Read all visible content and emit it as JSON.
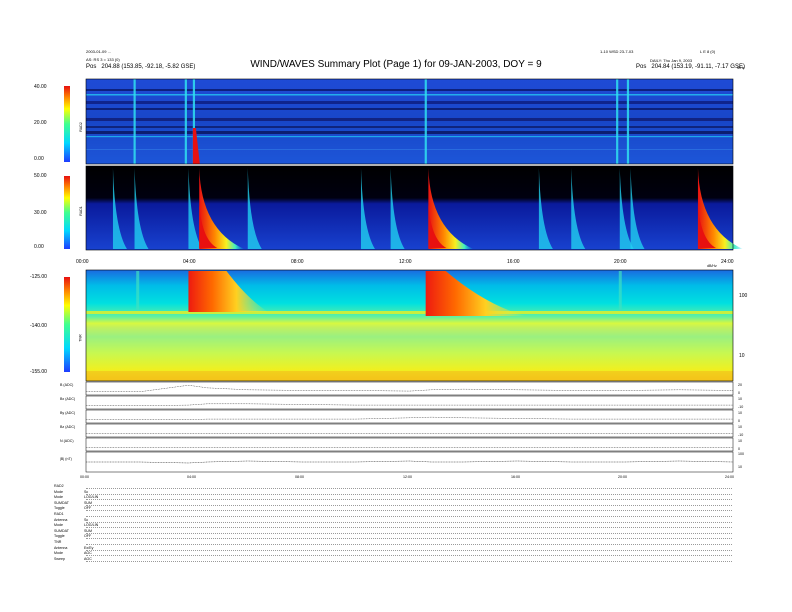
{
  "header": {
    "left_line1": "2003-01-09 ...",
    "left_line2": "AS: RS 3 = 133 (0)",
    "left_pos_label": "Pos",
    "left_pos_value": "204.88 (153.85, -92.18, -5.82 GSE)",
    "right_line1": "1-10 WSD 23-7-03",
    "right_line2": "L E 8 (0)",
    "right_line3": "DAILY: Thu Jan 9, 2003",
    "right_pos_label": "Pos",
    "right_pos_value": "204.84 (153.19, -91.11, -7.17 GSE)",
    "title": "WIND/WAVES Summary Plot (Page 1) for 09-JAN-2003, DOY = 9"
  },
  "panels": {
    "rad2": {
      "label": "RAD2",
      "ticks": [
        "40.00",
        "20.00",
        "0.00"
      ]
    },
    "rad1": {
      "label": "RAD1",
      "ticks": [
        "50.00",
        "30.00",
        "0.00"
      ]
    },
    "tnr": {
      "label": "TNR",
      "ticks": [
        "-125.00",
        "-140.00",
        "-155.00"
      ],
      "right_ticks": [
        "100",
        "10"
      ]
    },
    "time_ticks": [
      "00:00",
      "04:00",
      "08:00",
      "12:00",
      "16:00",
      "20:00",
      "24:00"
    ],
    "top_right_mark": "MHz",
    "mid_right_mark": "dB/Hz"
  },
  "mfi": {
    "labels": [
      "B (ADC)",
      "Bx (ADC)",
      "By (ADC)",
      "Bz (ADC)",
      "N (ADC)",
      "|B| (nT)"
    ],
    "right_ticks": [
      [
        "20",
        "0"
      ],
      [
        "10",
        "-10"
      ],
      [
        "10",
        "0"
      ],
      [
        "10",
        "-10"
      ],
      [
        "10",
        "0"
      ],
      [
        "100",
        "10"
      ]
    ],
    "time_ticks": [
      "00:00",
      "04:00",
      "08:00",
      "12:00",
      "16:00",
      "20:00",
      "24:00"
    ]
  },
  "params": [
    {
      "k": "RAD2",
      "v": ""
    },
    {
      "k": "Mode",
      "v": "Sc"
    },
    {
      "k": "Mode",
      "v": "LOG/LIN"
    },
    {
      "k": "SUMDAT",
      "v": "SUM"
    },
    {
      "k": "Toggle",
      "v": "OFF"
    },
    {
      "k": "RAD1",
      "v": ""
    },
    {
      "k": "Antenna",
      "v": "Sc"
    },
    {
      "k": "Mode",
      "v": "LOG/LIN"
    },
    {
      "k": "SUMDAT",
      "v": "SUM"
    },
    {
      "k": "Toggle",
      "v": "OFF"
    },
    {
      "k": "TNR",
      "v": ""
    },
    {
      "k": "Antenna",
      "v": "Ex/Ey"
    },
    {
      "k": "Mode",
      "v": "AGC"
    },
    {
      "k": "Sweep",
      "v": "AGC"
    }
  ],
  "chart_data": [
    {
      "type": "heatmap",
      "title": "WIND/WAVES Summary Plot (Page 1) for 09-JAN-2003, DOY = 9",
      "panel": "RAD2",
      "ylabel": "RAD2",
      "xlim": [
        "00:00",
        "24:00"
      ],
      "colorbar_ticks": [
        "40.00",
        "20.00",
        "0.00"
      ],
      "bursts_hours": [
        1.8,
        3.7,
        4.0,
        12.6,
        19.7,
        20.1
      ]
    },
    {
      "type": "heatmap",
      "panel": "RAD1",
      "ylabel": "RAD1",
      "xlim": [
        "00:00",
        "24:00"
      ],
      "colorbar_ticks": [
        "50.00",
        "30.00",
        "0.00"
      ],
      "bursts_hours": [
        1.0,
        1.8,
        3.8,
        4.2,
        6.0,
        10.2,
        11.3,
        12.7,
        16.8,
        18.0,
        19.8,
        20.2,
        22.7
      ]
    },
    {
      "type": "heatmap",
      "panel": "TNR",
      "ylabel": "TNR",
      "xlim": [
        "00:00",
        "24:00"
      ],
      "colorbar_ticks": [
        "-125.00",
        "-140.00",
        "-155.00"
      ],
      "right_axis_ticks": [
        "100",
        "10"
      ],
      "bursts_hours": [
        1.9,
        3.8,
        12.6,
        19.8
      ]
    },
    {
      "type": "line",
      "panel": "MFI",
      "x": [
        0,
        2,
        3.8,
        4.5,
        6,
        8,
        10,
        12,
        12.8,
        14,
        16,
        18,
        20,
        22,
        24
      ],
      "series": [
        {
          "name": "B (ADC)",
          "values": [
            0,
            0,
            1,
            0.6,
            0.3,
            0.2,
            0.2,
            0.1,
            0.3,
            0.4,
            0.3,
            0.2,
            0.2,
            0.3,
            0.2
          ]
        },
        {
          "name": "Bx (ADC)",
          "values": [
            0,
            0,
            0.1,
            0.3,
            0.3,
            0.2,
            0.1,
            0.1,
            0.1,
            0.1,
            0.1,
            0.1,
            0.1,
            0.1,
            0.1
          ]
        },
        {
          "name": "By (ADC)",
          "values": [
            0,
            0,
            0,
            0.1,
            0.1,
            0.1,
            0.1,
            0.3,
            0.4,
            0.3,
            0.2,
            0.1,
            0.1,
            0.1,
            0.1
          ]
        },
        {
          "name": "Bz (ADC)",
          "values": [
            0,
            0,
            0,
            0,
            0,
            0,
            0,
            0,
            0,
            0,
            0,
            0,
            0,
            0,
            0
          ]
        },
        {
          "name": "N (ADC)",
          "values": [
            0,
            0,
            0,
            0,
            0,
            0,
            0,
            0,
            0,
            0,
            0,
            0,
            0,
            0,
            0
          ]
        },
        {
          "name": "|B| (nT)",
          "values": [
            0.5,
            0.5,
            0.4,
            0.5,
            0.6,
            0.5,
            0.5,
            0.6,
            0.5,
            0.5,
            0.6,
            0.5,
            0.5,
            0.6,
            0.5
          ]
        }
      ]
    }
  ]
}
